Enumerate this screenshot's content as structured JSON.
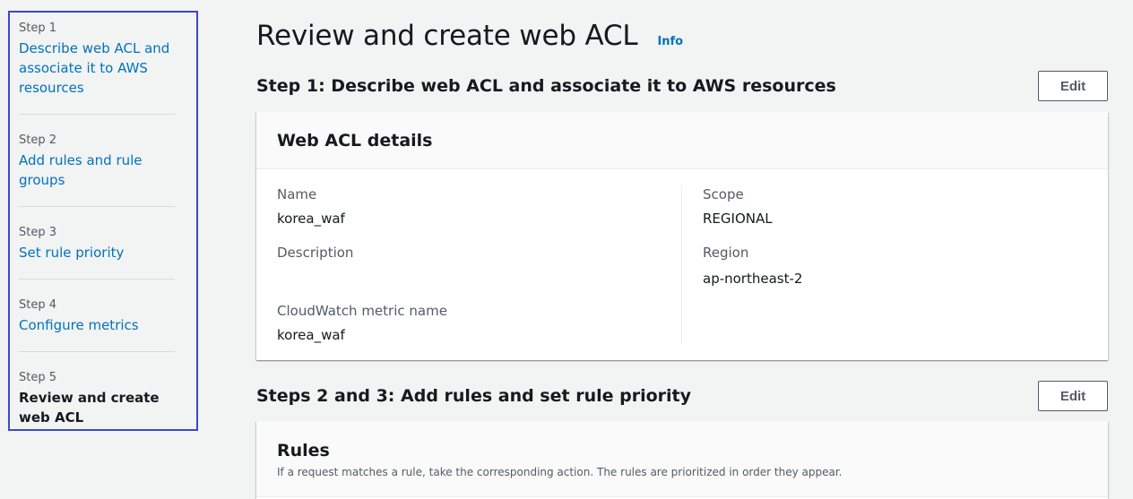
{
  "wizard": {
    "steps": [
      {
        "num": "Step 1",
        "label": "Describe web ACL and associate it to AWS resources"
      },
      {
        "num": "Step 2",
        "label": "Add rules and rule groups"
      },
      {
        "num": "Step 3",
        "label": "Set rule priority"
      },
      {
        "num": "Step 4",
        "label": "Configure metrics"
      },
      {
        "num": "Step 5",
        "label": "Review and create web ACL"
      }
    ],
    "current_step": 5
  },
  "header": {
    "title": "Review and create web ACL",
    "info": "Info"
  },
  "section1": {
    "title": "Step 1: Describe web ACL and associate it to AWS resources",
    "edit_label": "Edit",
    "panel_title": "Web ACL details",
    "fields": {
      "name_key": "Name",
      "name_val": "korea_waf",
      "description_key": "Description",
      "description_val": "",
      "metric_key": "CloudWatch metric name",
      "metric_val": "korea_waf",
      "scope_key": "Scope",
      "scope_val": "REGIONAL",
      "region_key": "Region",
      "region_val": "ap-northeast-2"
    }
  },
  "section2": {
    "title": "Steps 2 and 3: Add rules and set rule priority",
    "edit_label": "Edit",
    "panel_title": "Rules",
    "panel_desc": "If a request matches a rule, take the corresponding action. The rules are prioritized in order they appear."
  },
  "colors": {
    "link": "#0073bb",
    "focus_border": "#3b48cc",
    "background": "#f2f3f3"
  }
}
